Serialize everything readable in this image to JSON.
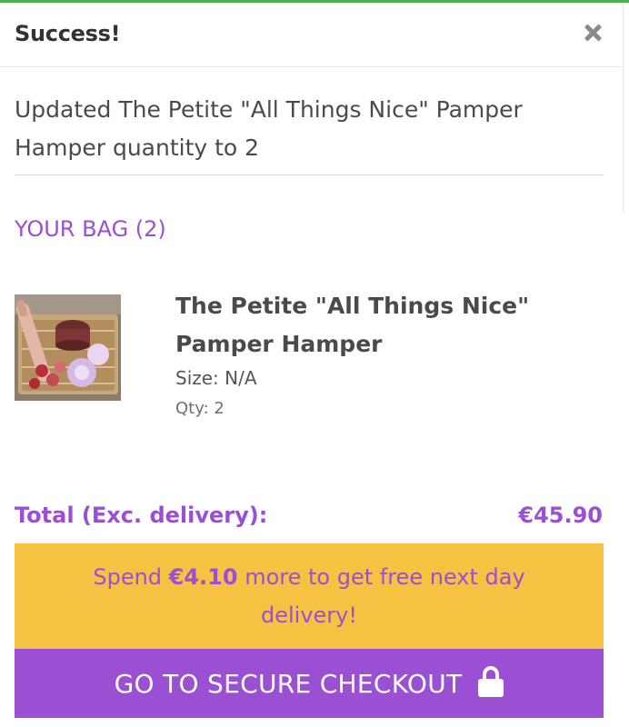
{
  "header": {
    "title": "Success!"
  },
  "message": {
    "text": "Updated The Petite \"All Things Nice\" Pamper Hamper quantity to 2"
  },
  "bag": {
    "title": "YOUR BAG (2)",
    "item": {
      "name": "The Petite \"All Things Nice\" Pamper Hamper",
      "size": "Size: N/A",
      "qty": "Qty: 2"
    }
  },
  "total": {
    "label": "Total (Exc. delivery):",
    "value": "€45.90"
  },
  "promo": {
    "prefix": "Spend ",
    "amount": "€4.10",
    "suffix": " more to get free next day delivery!"
  },
  "checkout": {
    "label": "GO TO SECURE CHECKOUT",
    "icon": "lock-icon"
  },
  "colors": {
    "accent": "#9b4fd3",
    "promo_bg": "#f5c242",
    "success_line": "#4caf50"
  }
}
